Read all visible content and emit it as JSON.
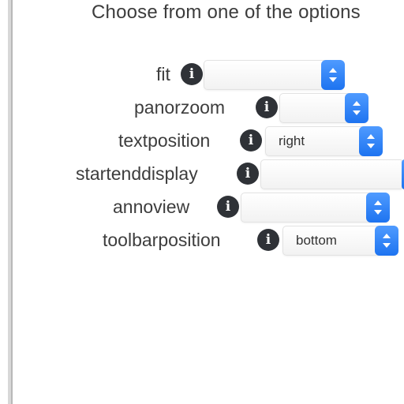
{
  "heading": "Choose from one of the options",
  "options": [
    {
      "label": "fit",
      "value": ""
    },
    {
      "label": "panorzoom",
      "value": ""
    },
    {
      "label": "textposition",
      "value": "right"
    },
    {
      "label": "startenddisplay",
      "value": ""
    },
    {
      "label": "annoview",
      "value": ""
    },
    {
      "label": "toolbarposition",
      "value": "bottom"
    }
  ],
  "info_icon_glyph": "i",
  "colors": {
    "accent": "#1d73f0",
    "info_icon_bg": "#2f3237"
  }
}
